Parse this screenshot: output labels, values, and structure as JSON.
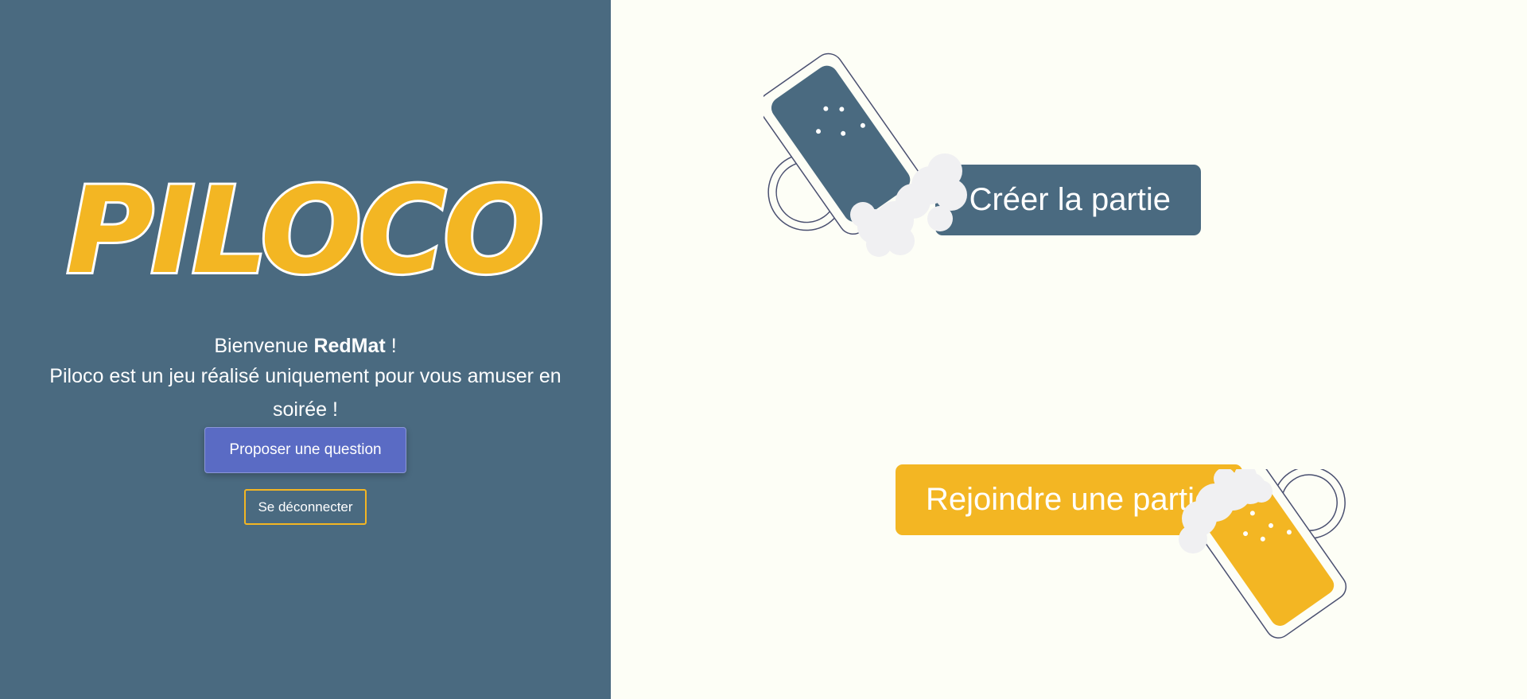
{
  "app": {
    "title": "Piloco"
  },
  "colors": {
    "panel": "#4a6a80",
    "accent": "#f3b623",
    "background": "#fdfef6",
    "propose": "#5a6bc4",
    "foam": "#f0f0f2"
  },
  "sidebar": {
    "logo_text": "PILOCO",
    "welcome_prefix": "Bienvenue ",
    "username": "RedMat",
    "welcome_suffix": " !",
    "tagline": "Piloco est un jeu réalisé uniquement pour vous amuser en soirée !",
    "propose_label": "Proposer une question",
    "logout_label": "Se déconnecter"
  },
  "main": {
    "create_label": "Créer la partie",
    "join_label": "Rejoindre une partie",
    "icons": [
      "beer-mug-icon",
      "beer-mug-icon"
    ]
  }
}
